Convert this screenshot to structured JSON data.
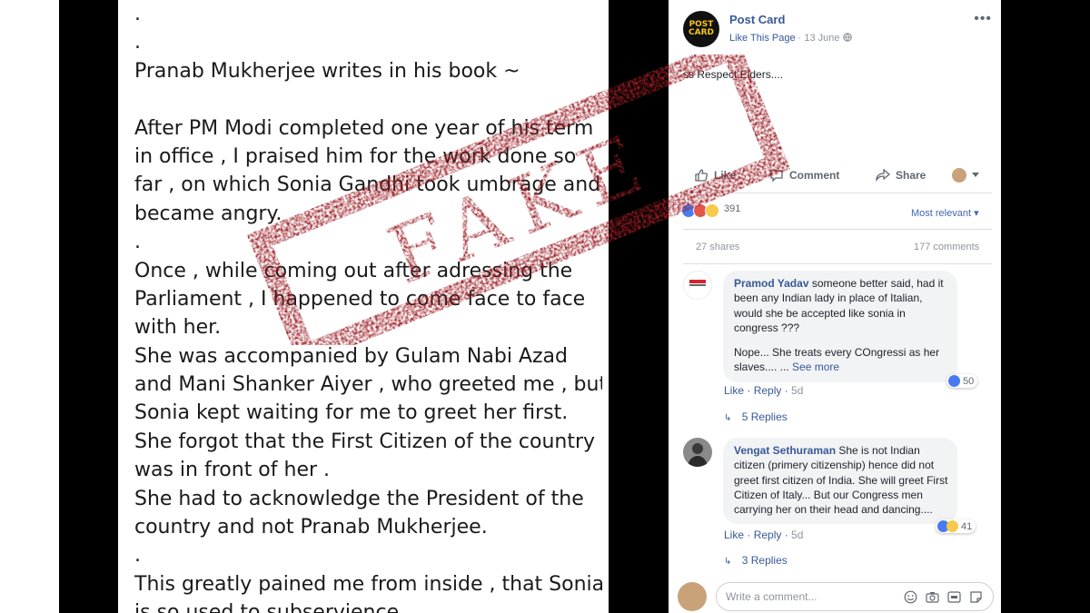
{
  "left_text": {
    "lines": [
      ".",
      ".",
      "Pranab Mukherjee writes in his book ~",
      "",
      "After PM Modi completed one year of his term",
      "in office , I praised him for the work done so",
      "far , on which Sonia Gandhi took umbrage and",
      "became angry.",
      ".",
      "Once , while coming out after adressing the",
      "Parliament , I happened to come face to face",
      "with her.",
      "She was accompanied by Gulam Nabi Azad",
      "and Mani Shanker Aiyer , who greeted me , but",
      "Sonia kept waiting for me to greet her first.",
      "She forgot that the First Citizen of the country",
      "was in front of her .",
      "She had to acknowledge the President of the",
      "country and not Pranab Mukherjee.",
      ".",
      "This greatly pained me from inside , that Sonia",
      "is so used to subservience ."
    ]
  },
  "stamp": {
    "text": "FAKE",
    "color": "#9b1c24"
  },
  "post": {
    "page_logo_line1": "POST",
    "page_logo_line2": "CARD",
    "page_name": "Post Card",
    "like_page": "Like This Page",
    "date": "13 June",
    "text": "ss Respect Elders....",
    "actions": {
      "like": "Like",
      "comment": "Comment",
      "share": "Share"
    },
    "reaction_count": "391",
    "sort_label": "Most relevant",
    "shares": "27 shares",
    "comments_count": "177 comments"
  },
  "comments": [
    {
      "author": "Pramod Yadav",
      "text": "someone better said, had it been any Indian lady in place of Italian, would she be accepted like sonia in congress ???",
      "text2": "Nope... She treats every COngressi as her slaves.... ...",
      "see_more": "See more",
      "reactions": "50",
      "like": "Like",
      "reply": "Reply",
      "time": "5d",
      "replies": "5 Replies"
    },
    {
      "author": "Vengat Sethuraman",
      "text": "She is not Indian citizen (primery citizenship) hence did not greet first citizen of India. She will greet First Citizen of Italy... But our Congress men carrying her on their head and dancing....",
      "reactions": "41",
      "like": "Like",
      "reply": "Reply",
      "time": "5d",
      "replies": "3 Replies"
    }
  ],
  "write_comment": {
    "placeholder": "Write a comment..."
  },
  "colors": {
    "facebook_blue": "#365899",
    "link_blue": "#385898",
    "muted_gray": "#90949c",
    "stamp_red": "#9b1c24"
  }
}
